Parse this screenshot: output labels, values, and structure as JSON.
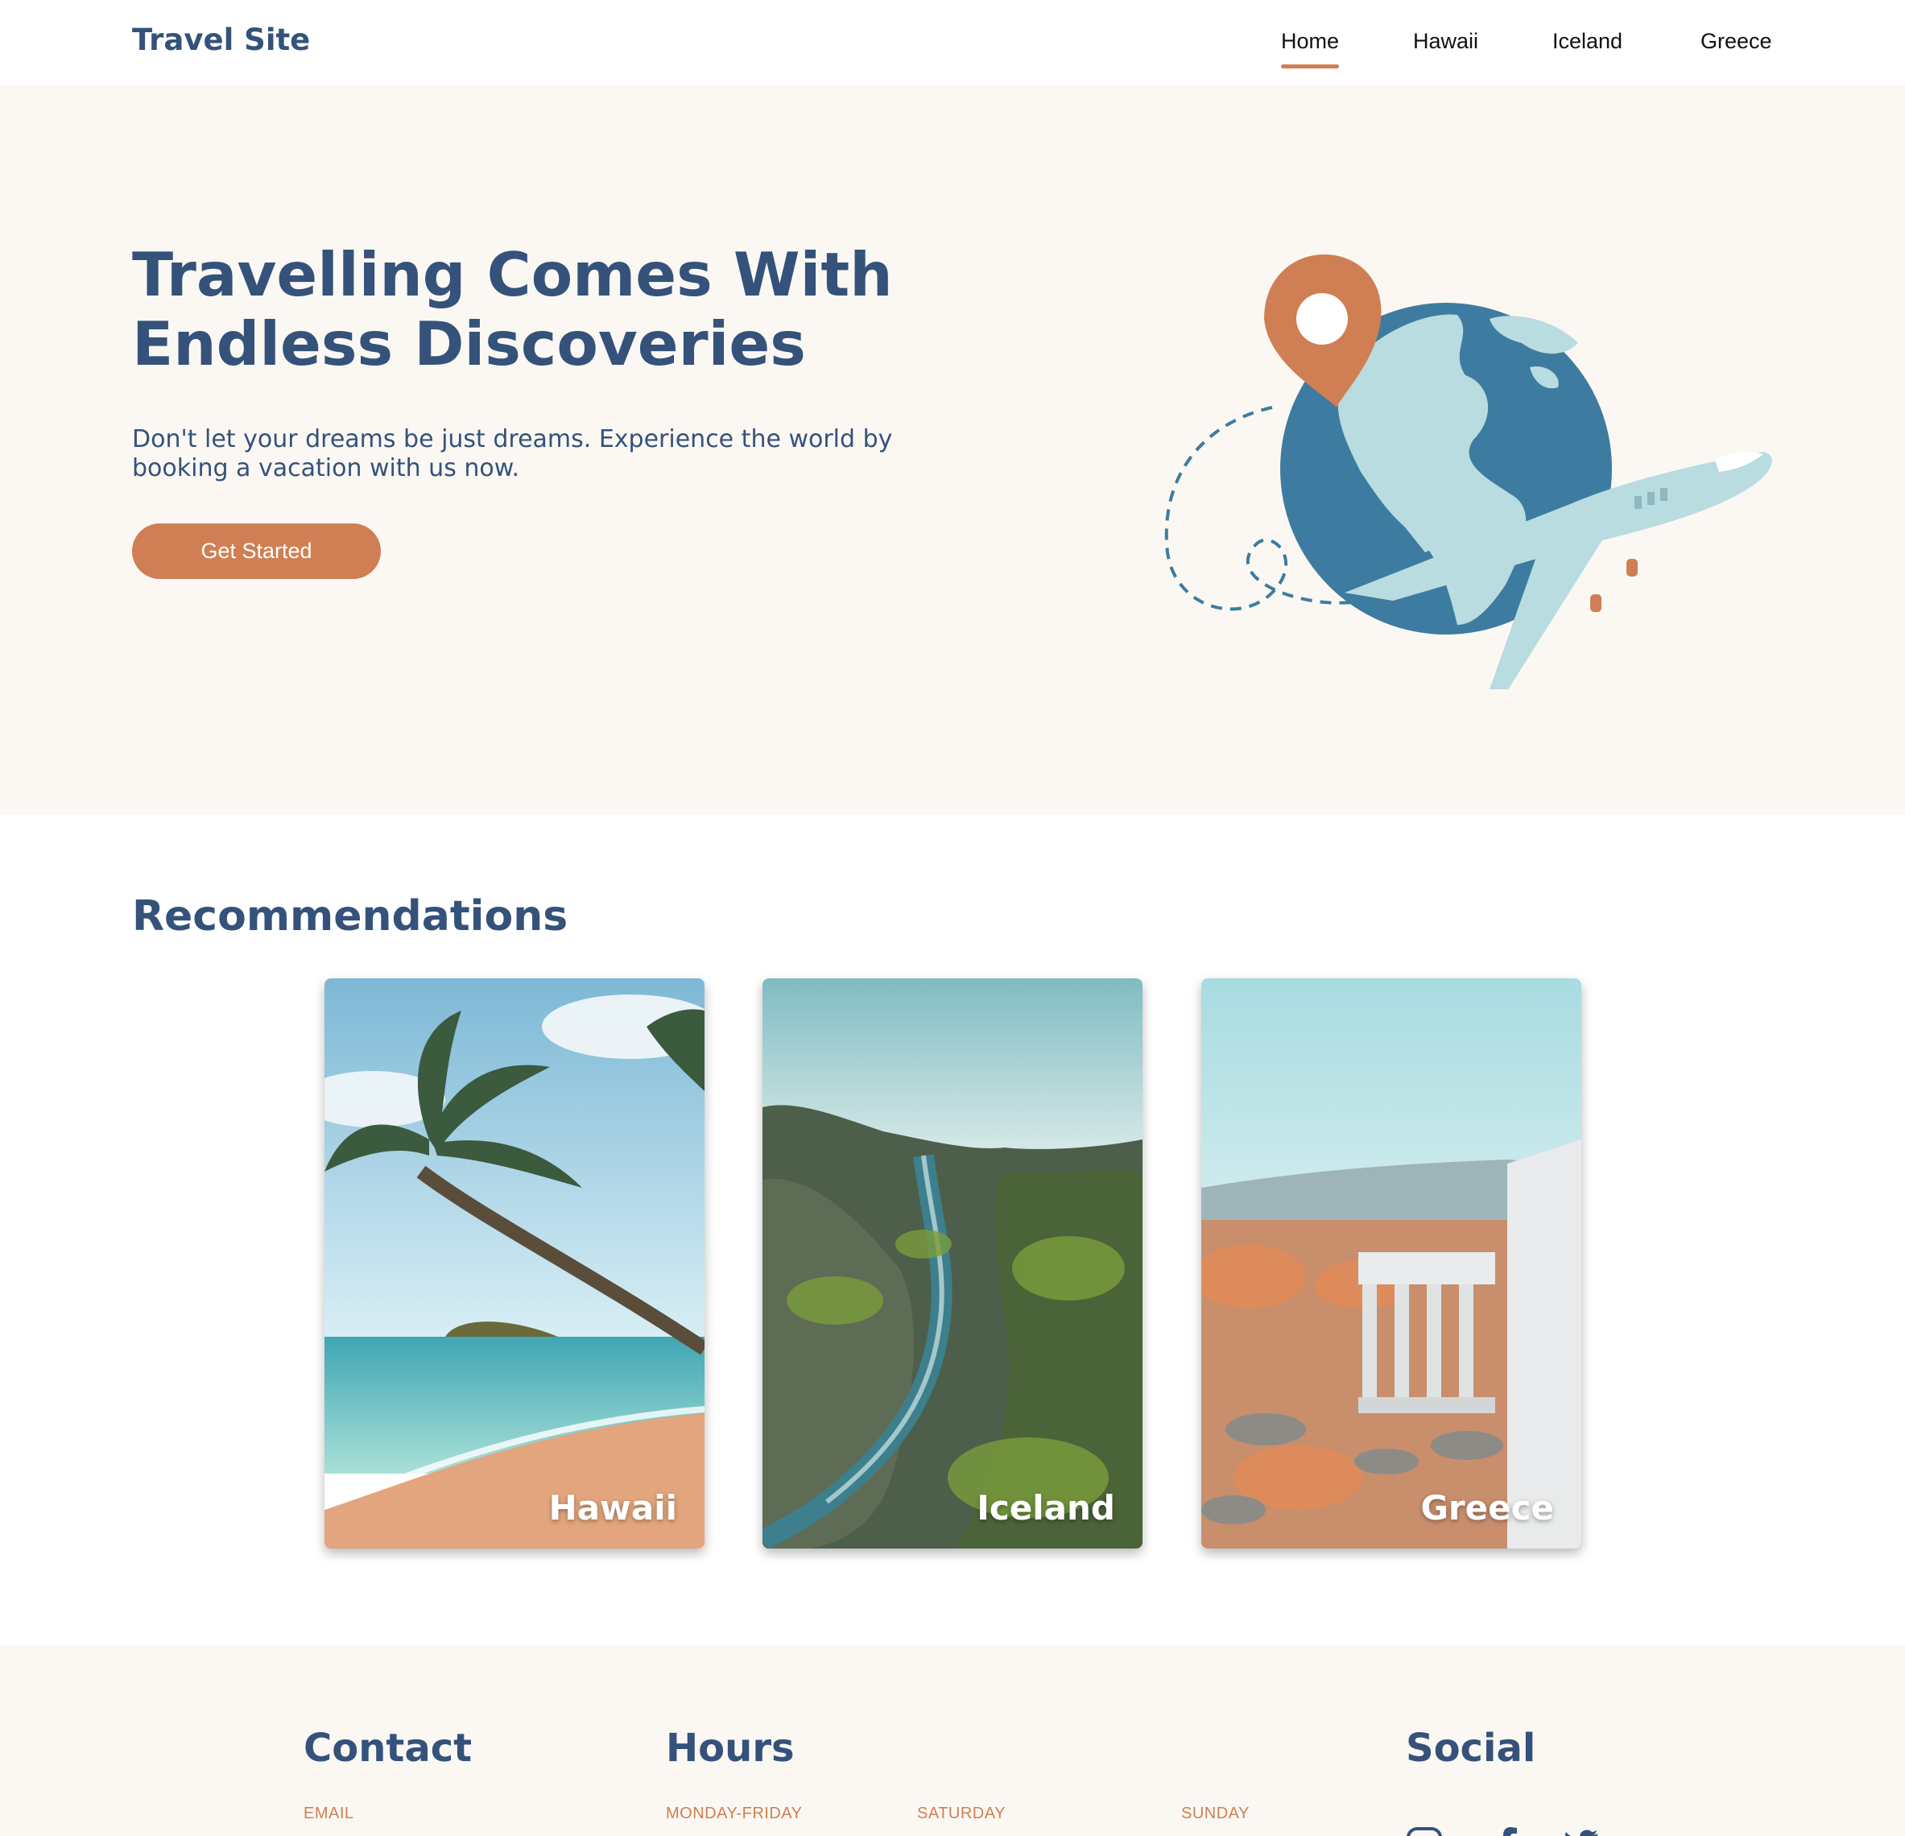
{
  "header": {
    "logo": "Travel Site",
    "nav": [
      "Home",
      "Hawaii",
      "Iceland",
      "Greece"
    ],
    "active": "Home"
  },
  "hero": {
    "title": "Travelling Comes With Endless Discoveries",
    "subtitle": "Don't let your dreams be just dreams. Experience the world by booking a vacation with us now.",
    "cta": "Get Started",
    "illustration_icons": [
      "location-pin-icon",
      "globe-icon",
      "airplane-icon"
    ]
  },
  "recommendations": {
    "title": "Recommendations",
    "cards": [
      {
        "label": "Hawaii"
      },
      {
        "label": "Iceland"
      },
      {
        "label": "Greece"
      }
    ]
  },
  "footer": {
    "contact": {
      "heading": "Contact",
      "labels": [
        "EMAIL"
      ]
    },
    "hours": {
      "heading": "Hours",
      "labels": [
        "MONDAY-FRIDAY",
        "SATURDAY",
        "SUNDAY"
      ]
    },
    "social": {
      "heading": "Social",
      "icons": [
        "instagram-icon",
        "facebook-icon",
        "twitter-icon"
      ]
    }
  },
  "colors": {
    "primary": "#34527a",
    "accent": "#cf7f53",
    "hero_bg": "#fbf8f4",
    "globe": "#3d7ca0",
    "land": "#b8dcdf"
  }
}
